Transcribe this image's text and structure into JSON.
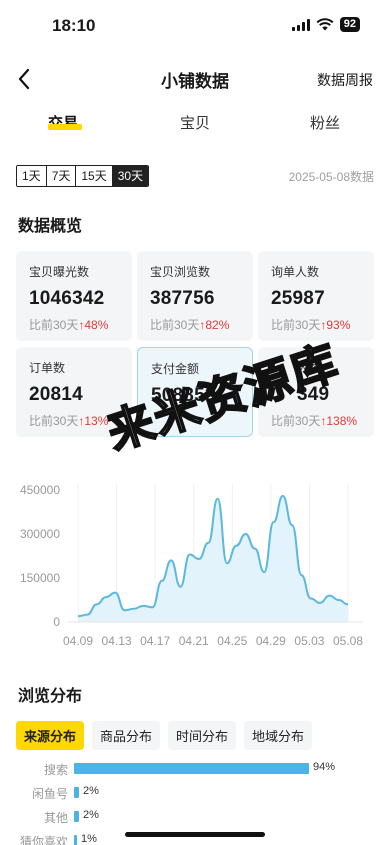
{
  "status": {
    "time": "18:10",
    "battery": "92"
  },
  "nav": {
    "title": "小铺数据",
    "right_link": "数据周报"
  },
  "tabs": [
    {
      "label": "交易",
      "active": true
    },
    {
      "label": "宝贝",
      "active": false
    },
    {
      "label": "粉丝",
      "active": false
    }
  ],
  "range": {
    "options": [
      "1天",
      "7天",
      "15天",
      "30天"
    ],
    "selected": "30天",
    "date": "2025-05-08数据"
  },
  "overview": {
    "title": "数据概览",
    "cards": [
      {
        "label": "宝贝曝光数",
        "value": "1046342",
        "compare": "比前30天",
        "change": "↑48%"
      },
      {
        "label": "宝贝浏览数",
        "value": "387756",
        "compare": "比前30天",
        "change": "↑82%"
      },
      {
        "label": "询单人数",
        "value": "25987",
        "compare": "比前30天",
        "change": "↑93%"
      },
      {
        "label": "订单数",
        "value": "20814",
        "compare": "比前30天",
        "change": "↑13%"
      },
      {
        "label": "支付金额",
        "value": "508853",
        "compare": "",
        "change": ""
      },
      {
        "label": "人数",
        "value": "349",
        "compare": "比前30天",
        "change": "↑138%"
      }
    ]
  },
  "watermark": "来米资源库",
  "chart_data": {
    "type": "area",
    "x_labels": [
      "04.09",
      "04.13",
      "04.17",
      "04.21",
      "04.25",
      "04.29",
      "05.03",
      "05.08"
    ],
    "y_ticks": [
      "450000",
      "300000",
      "150000",
      "0"
    ],
    "ylim": [
      0,
      450000
    ],
    "color": "#5bb8e0",
    "fill": "#e3f3fb",
    "series": [
      {
        "values": [
          20000,
          25000,
          60000,
          85000,
          100000,
          40000,
          45000,
          55000,
          50000,
          140000,
          210000,
          120000,
          230000,
          215000,
          270000,
          420000,
          200000,
          260000,
          300000,
          250000,
          170000,
          340000,
          430000,
          330000,
          160000,
          80000,
          65000,
          90000,
          75000,
          60000
        ]
      }
    ]
  },
  "distribution": {
    "title": "浏览分布",
    "tabs": [
      {
        "label": "来源分布",
        "active": true
      },
      {
        "label": "商品分布",
        "active": false
      },
      {
        "label": "时间分布",
        "active": false
      },
      {
        "label": "地域分布",
        "active": false
      }
    ],
    "bars": [
      {
        "label": "搜索",
        "percent": 94,
        "display": "94%"
      },
      {
        "label": "闲鱼号",
        "percent": 2,
        "display": "2%"
      },
      {
        "label": "其他",
        "percent": 2,
        "display": "2%"
      },
      {
        "label": "猜你喜欢",
        "percent": 1,
        "display": "1%"
      }
    ]
  }
}
